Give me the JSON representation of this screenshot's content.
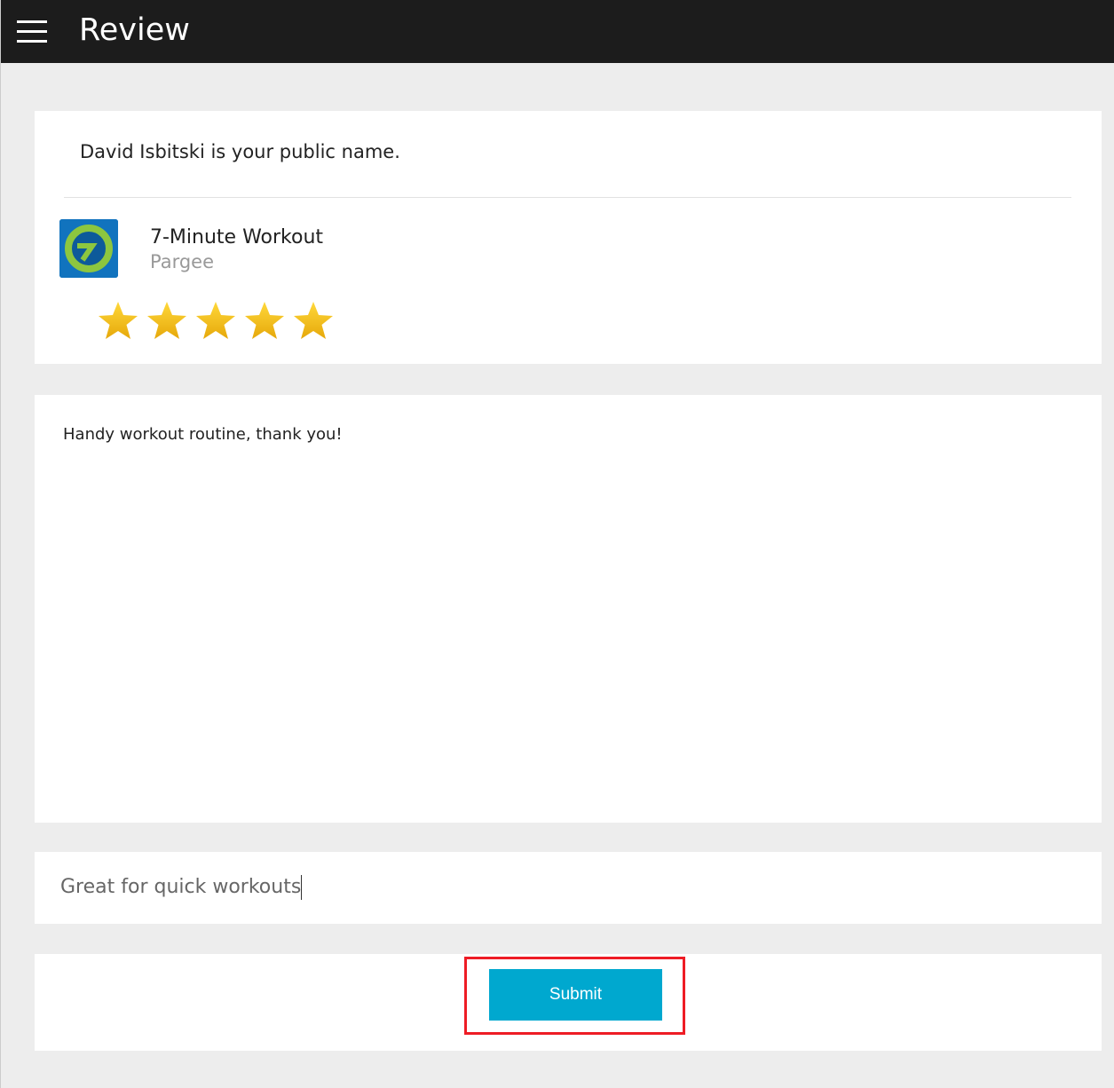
{
  "header": {
    "title": "Review",
    "menu_icon": "hamburger-menu-icon"
  },
  "profile": {
    "public_name_text": "David Isbitski is your public name."
  },
  "app": {
    "name": "7-Minute Workout",
    "developer": "Pargee",
    "icon": "app-logo-icon"
  },
  "rating": {
    "value": 5,
    "max": 5,
    "star_color": "#f2b90f"
  },
  "review": {
    "body": "Handy workout routine, thank you!",
    "headline": "Great for quick workouts"
  },
  "actions": {
    "submit_label": "Submit",
    "accent": "#00a8cf",
    "highlight_color": "#ee1c25"
  }
}
